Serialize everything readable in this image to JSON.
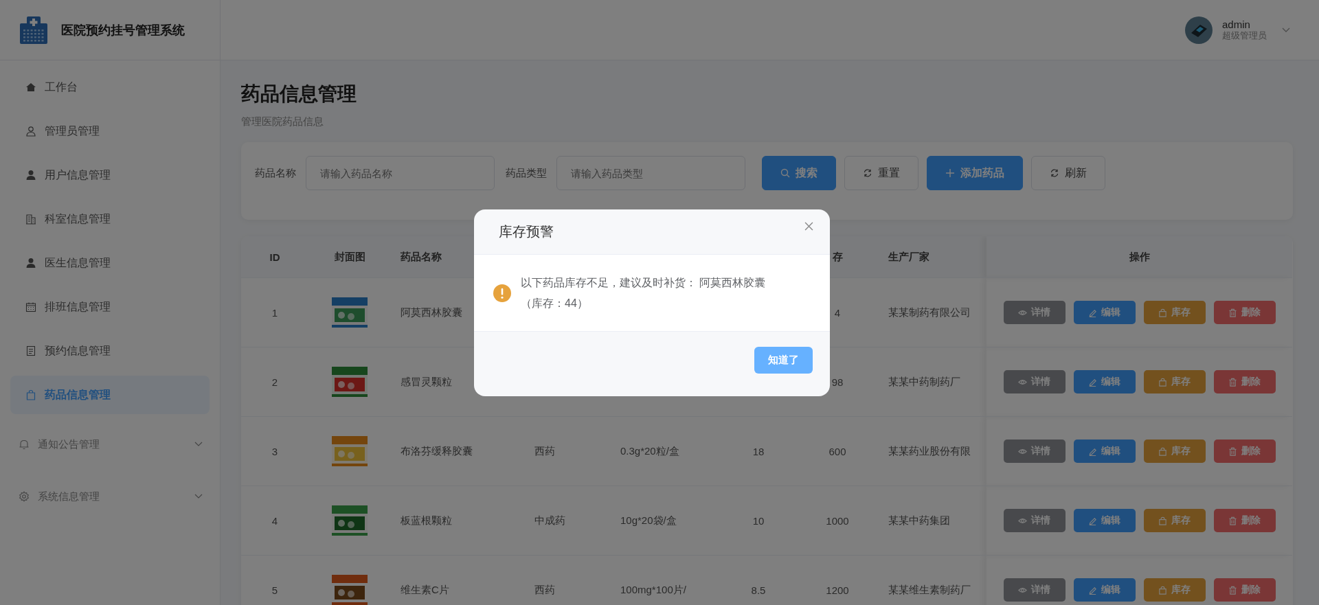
{
  "app": {
    "title": "医院预约挂号管理系统"
  },
  "user": {
    "name": "admin",
    "role": "超级管理员"
  },
  "sidebar": {
    "items": [
      {
        "label": "工作台",
        "selected": false,
        "has_submenu": false
      },
      {
        "label": "管理员管理",
        "selected": false,
        "has_submenu": false
      },
      {
        "label": "用户信息管理",
        "selected": false,
        "has_submenu": false
      },
      {
        "label": "科室信息管理",
        "selected": false,
        "has_submenu": false
      },
      {
        "label": "医生信息管理",
        "selected": false,
        "has_submenu": false
      },
      {
        "label": "排班信息管理",
        "selected": false,
        "has_submenu": false
      },
      {
        "label": "预约信息管理",
        "selected": false,
        "has_submenu": false
      },
      {
        "label": "药品信息管理",
        "selected": true,
        "has_submenu": false
      },
      {
        "label": "通知公告管理",
        "selected": false,
        "has_submenu": true
      },
      {
        "label": "系统信息管理",
        "selected": false,
        "has_submenu": true
      }
    ]
  },
  "page": {
    "title": "药品信息管理",
    "subtitle": "管理医院药品信息"
  },
  "filters": [
    {
      "label": "药品名称",
      "placeholder": "请输入药品名称"
    },
    {
      "label": "药品类型",
      "placeholder": "请输入药品类型"
    }
  ],
  "toolbar": [
    {
      "label": "搜索",
      "kind": "primary"
    },
    {
      "label": "重置",
      "kind": "default"
    },
    {
      "label": "添加药品",
      "kind": "primary"
    },
    {
      "label": "刷新",
      "kind": "default"
    }
  ],
  "table": {
    "columns": [
      "ID",
      "封面图",
      "药品名称",
      null,
      null,
      null,
      "存",
      "生产厂家",
      "操作"
    ],
    "rows": [
      {
        "id": "1",
        "name": "阿莫西林胶囊",
        "type": null,
        "spec": null,
        "price": null,
        "stock": "4",
        "maker": "某某制药有限公司",
        "actions": [
          {
            "label": "详情",
            "kind": "info"
          },
          {
            "label": "编辑",
            "kind": "primary"
          },
          {
            "label": "库存",
            "kind": "warning"
          },
          {
            "label": "删除",
            "kind": "danger"
          }
        ]
      },
      {
        "id": "2",
        "name": "感冒灵颗粒",
        "type": null,
        "spec": null,
        "price": null,
        "stock": "98",
        "maker": "某某中药制药厂",
        "actions": [
          {
            "label": "详情",
            "kind": "info"
          },
          {
            "label": "编辑",
            "kind": "primary"
          },
          {
            "label": "库存",
            "kind": "warning"
          },
          {
            "label": "删除",
            "kind": "danger"
          }
        ]
      },
      {
        "id": "3",
        "name": "布洛芬缓释胶囊",
        "type": "西药",
        "spec": "0.3g*20粒/盒",
        "price": "18",
        "stock": "600",
        "maker": "某某药业股份有限",
        "actions": [
          {
            "label": "详情",
            "kind": "info"
          },
          {
            "label": "编辑",
            "kind": "primary"
          },
          {
            "label": "库存",
            "kind": "warning"
          },
          {
            "label": "删除",
            "kind": "danger"
          }
        ]
      },
      {
        "id": "4",
        "name": "板蓝根颗粒",
        "type": "中成药",
        "spec": "10g*20袋/盒",
        "price": "10",
        "stock": "1000",
        "maker": "某某中药集团",
        "actions": [
          {
            "label": "详情",
            "kind": "info"
          },
          {
            "label": "编辑",
            "kind": "primary"
          },
          {
            "label": "库存",
            "kind": "warning"
          },
          {
            "label": "删除",
            "kind": "danger"
          }
        ]
      },
      {
        "id": "5",
        "name": "维生素C片",
        "type": "西药",
        "spec": "100mg*100片/",
        "price": "8.5",
        "stock": "1200",
        "maker": "某某维生素制药厂",
        "actions": [
          {
            "label": "详情",
            "kind": "info"
          },
          {
            "label": "编辑",
            "kind": "primary"
          },
          {
            "label": "库存",
            "kind": "warning"
          },
          {
            "label": "删除",
            "kind": "danger"
          }
        ]
      }
    ]
  },
  "dialog": {
    "title": "库存预警",
    "message": "以下药品库存不足，建议及时补货： 阿莫西林胶囊（库存：44）",
    "button": "知道了"
  }
}
